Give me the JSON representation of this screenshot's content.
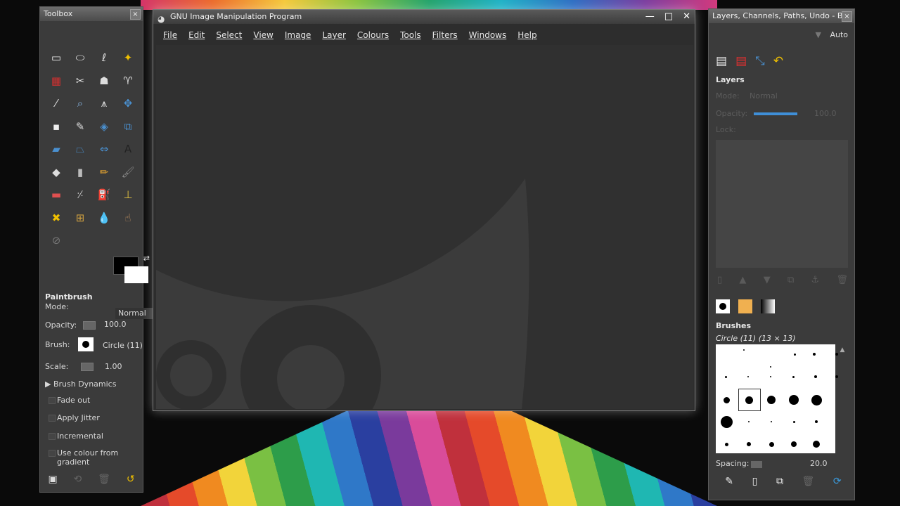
{
  "toolbox": {
    "title": "Toolbox",
    "close_glyph": "×",
    "tools": [
      {
        "name": "rect-select-icon",
        "glyph": "▭"
      },
      {
        "name": "ellipse-select-icon",
        "glyph": "⬭"
      },
      {
        "name": "free-select-icon",
        "glyph": "ℓ"
      },
      {
        "name": "fuzzy-select-icon",
        "glyph": "✦"
      },
      {
        "name": "color-select-icon",
        "glyph": "▦"
      },
      {
        "name": "scissors-select-icon",
        "glyph": "✂"
      },
      {
        "name": "foreground-select-icon",
        "glyph": "☗"
      },
      {
        "name": "paths-icon",
        "glyph": "♈"
      },
      {
        "name": "color-picker-icon",
        "glyph": "⁄"
      },
      {
        "name": "zoom-icon",
        "glyph": "⌕"
      },
      {
        "name": "measure-icon",
        "glyph": "⩚"
      },
      {
        "name": "move-icon",
        "glyph": "✥"
      },
      {
        "name": "align-icon",
        "glyph": "▪"
      },
      {
        "name": "crop-icon",
        "glyph": "✎"
      },
      {
        "name": "rotate-icon",
        "glyph": "◈"
      },
      {
        "name": "scale-icon",
        "glyph": "⧉"
      },
      {
        "name": "shear-icon",
        "glyph": "▰"
      },
      {
        "name": "perspective-icon",
        "glyph": "⏢"
      },
      {
        "name": "flip-icon",
        "glyph": "⇔"
      },
      {
        "name": "text-icon",
        "glyph": "A"
      },
      {
        "name": "bucket-fill-icon",
        "glyph": "◆"
      },
      {
        "name": "blend-icon",
        "glyph": "▮"
      },
      {
        "name": "pencil-icon",
        "glyph": "✏"
      },
      {
        "name": "paintbrush-icon",
        "glyph": "🖌"
      },
      {
        "name": "eraser-icon",
        "glyph": "▬"
      },
      {
        "name": "airbrush-icon",
        "glyph": "⸓"
      },
      {
        "name": "ink-icon",
        "glyph": "⛽"
      },
      {
        "name": "clone-icon",
        "glyph": "⊥"
      },
      {
        "name": "heal-icon",
        "glyph": "✖"
      },
      {
        "name": "perspective-clone-icon",
        "glyph": "⊞"
      },
      {
        "name": "blur-sharpen-icon",
        "glyph": "💧"
      },
      {
        "name": "smudge-icon",
        "glyph": "☝"
      },
      {
        "name": "dodge-burn-icon",
        "glyph": "⊘"
      }
    ],
    "options": {
      "title": "Paintbrush",
      "mode_label": "Mode:",
      "mode_value": "Normal",
      "opacity_label": "Opacity:",
      "opacity_value": "100.0",
      "brush_label": "Brush:",
      "brush_value": "Circle (11)",
      "scale_label": "Scale:",
      "scale_value": "1.00",
      "brush_dynamics": "Brush Dynamics",
      "fade_out": "Fade out",
      "apply_jitter": "Apply Jitter",
      "incremental": "Incremental",
      "use_gradient": "Use colour from gradient"
    }
  },
  "main": {
    "title": "GNU Image Manipulation Program",
    "menu": [
      "File",
      "Edit",
      "Select",
      "View",
      "Image",
      "Layer",
      "Colours",
      "Tools",
      "Filters",
      "Windows",
      "Help"
    ]
  },
  "dock": {
    "title": "Layers, Channels, Paths, Undo - Br...",
    "auto_label": "Auto",
    "layers_title": "Layers",
    "mode_label": "Mode:",
    "mode_value": "Normal",
    "opacity_label": "Opacity:",
    "opacity_value": "100.0",
    "lock_label": "Lock:",
    "brushes_title": "Brushes",
    "brush_name": "Circle (11) (13 × 13)",
    "spacing_label": "Spacing:",
    "spacing_value": "20.0"
  },
  "colors": {
    "foreground": "#000000",
    "background": "#ffffff"
  }
}
